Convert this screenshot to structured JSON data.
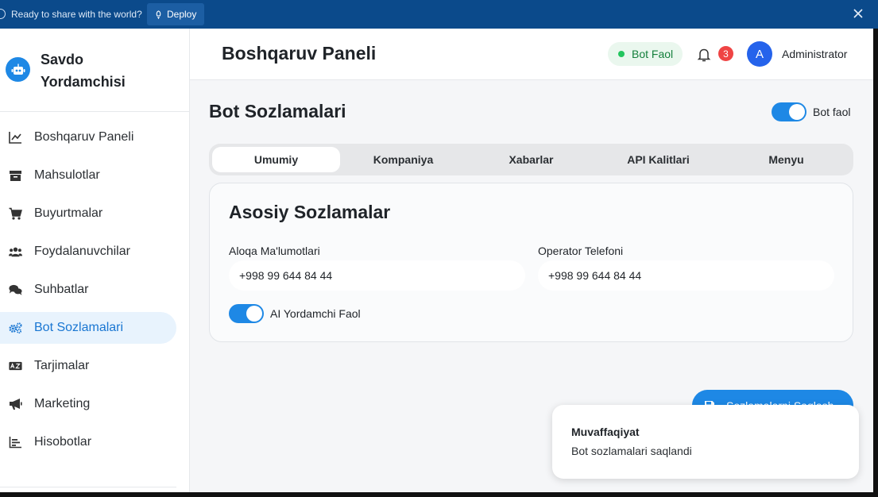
{
  "banner": {
    "message": "Ready to share with the world?",
    "deploy_label": "Deploy"
  },
  "sidebar": {
    "brand": "Savdo Yordamchisi",
    "items": [
      {
        "label": "Boshqaruv Paneli",
        "icon": "chart-line-icon",
        "active": false
      },
      {
        "label": "Mahsulotlar",
        "icon": "box-icon",
        "active": false
      },
      {
        "label": "Buyurtmalar",
        "icon": "cart-icon",
        "active": false
      },
      {
        "label": "Foydalanuvchilar",
        "icon": "users-icon",
        "active": false
      },
      {
        "label": "Suhbatlar",
        "icon": "chat-icon",
        "active": false
      },
      {
        "label": "Bot Sozlamalari",
        "icon": "gears-icon",
        "active": true
      },
      {
        "label": "Tarjimalar",
        "icon": "translate-icon",
        "active": false
      },
      {
        "label": "Marketing",
        "icon": "megaphone-icon",
        "active": false
      },
      {
        "label": "Hisobotlar",
        "icon": "report-icon",
        "active": false
      }
    ]
  },
  "header": {
    "title": "Boshqaruv Paneli",
    "status": "Bot Faol",
    "notifications": "3",
    "avatar_letter": "A",
    "user": "Administrator"
  },
  "main": {
    "title": "Bot Sozlamalari",
    "bot_toggle_label": "Bot faol",
    "bot_toggle_on": true,
    "tabs": [
      {
        "label": "Umumiy",
        "active": true
      },
      {
        "label": "Kompaniya",
        "active": false
      },
      {
        "label": "Xabarlar",
        "active": false
      },
      {
        "label": "API Kalitlari",
        "active": false
      },
      {
        "label": "Menyu",
        "active": false
      }
    ],
    "card": {
      "title": "Asosiy Sozlamalar",
      "contact_label": "Aloqa Ma'lumotlari",
      "contact_value": "+998 99 644 84 44",
      "operator_label": "Operator Telefoni",
      "operator_value": "+998 99 644 84 44",
      "ai_label": "AI Yordamchi Faol",
      "ai_on": true
    },
    "save_label": "Sozlamalarni Saqlash"
  },
  "toast": {
    "title": "Muvaffaqiyat",
    "message": "Bot sozlamalari saqlandi"
  },
  "colors": {
    "accent": "#1e88e5",
    "banner": "#0b4a8b",
    "success": "#22c55e",
    "danger": "#ef4444"
  }
}
